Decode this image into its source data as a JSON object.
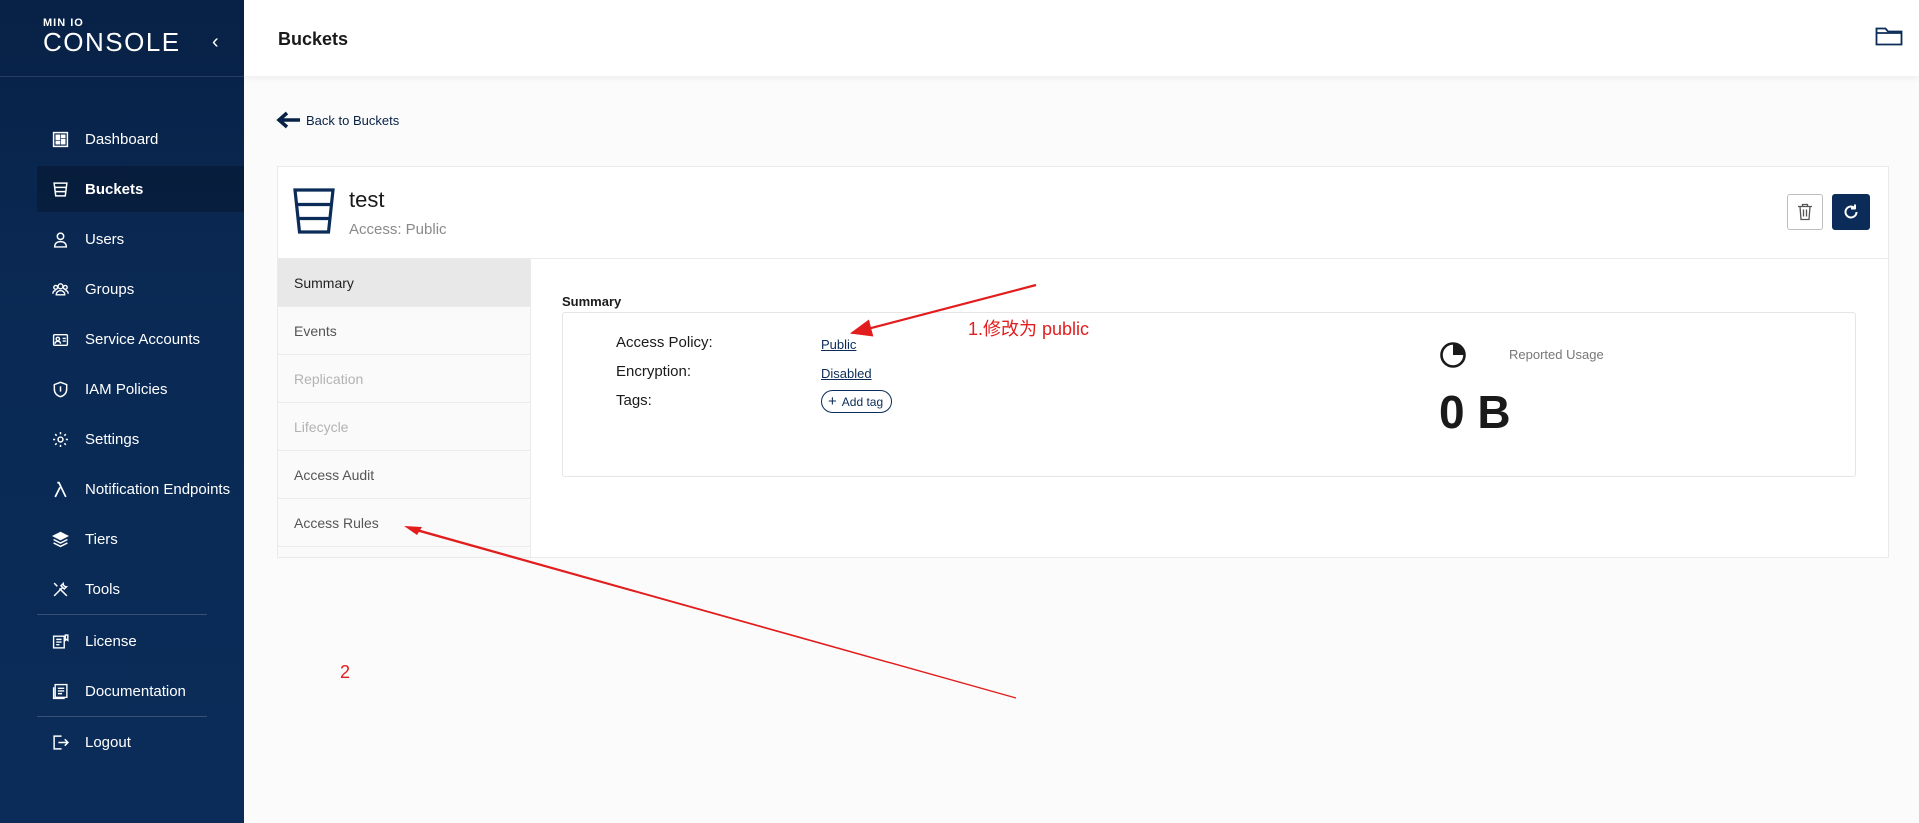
{
  "sidebar": {
    "logo_small": "MIN IO",
    "logo_big": "CONSOLE",
    "collapse_icon": "chevron-left-icon",
    "items": [
      {
        "label": "Dashboard",
        "icon": "dashboard-icon",
        "active": false
      },
      {
        "label": "Buckets",
        "icon": "bucket-icon",
        "active": true
      },
      {
        "label": "Users",
        "icon": "user-icon",
        "active": false
      },
      {
        "label": "Groups",
        "icon": "groups-icon",
        "active": false
      },
      {
        "label": "Service Accounts",
        "icon": "service-accounts-icon",
        "active": false
      },
      {
        "label": "IAM Policies",
        "icon": "shield-icon",
        "active": false
      },
      {
        "label": "Settings",
        "icon": "gear-icon",
        "active": false
      },
      {
        "label": "Notification Endpoints",
        "icon": "lambda-icon",
        "active": false
      },
      {
        "label": "Tiers",
        "icon": "layers-icon",
        "active": false
      },
      {
        "label": "Tools",
        "icon": "tools-icon",
        "active": false
      },
      {
        "label": "License",
        "icon": "license-icon",
        "active": false
      },
      {
        "label": "Documentation",
        "icon": "documentation-icon",
        "active": false
      },
      {
        "label": "Logout",
        "icon": "logout-icon",
        "active": false
      }
    ]
  },
  "header": {
    "title": "Buckets",
    "folder_icon": "folder-icon"
  },
  "back_link": "Back to Buckets",
  "bucket": {
    "name": "test",
    "access": "Access: Public"
  },
  "tabs": [
    {
      "label": "Summary",
      "state": "active"
    },
    {
      "label": "Events",
      "state": "normal"
    },
    {
      "label": "Replication",
      "state": "disabled"
    },
    {
      "label": "Lifecycle",
      "state": "disabled"
    },
    {
      "label": "Access Audit",
      "state": "normal"
    },
    {
      "label": "Access Rules",
      "state": "normal"
    }
  ],
  "summary": {
    "title": "Summary",
    "access_policy_label": "Access Policy:",
    "access_policy_value": "Public",
    "encryption_label": "Encryption:",
    "encryption_value": "Disabled",
    "tags_label": "Tags:",
    "add_tag_label": "Add tag",
    "usage_label": "Reported Usage",
    "usage_value": "0 B"
  },
  "annotations": {
    "note1": "1.修改为 public",
    "note2": "2",
    "color": "#e21d1d"
  },
  "colors": {
    "sidebar": "#082146",
    "accent": "#0b2c58"
  }
}
